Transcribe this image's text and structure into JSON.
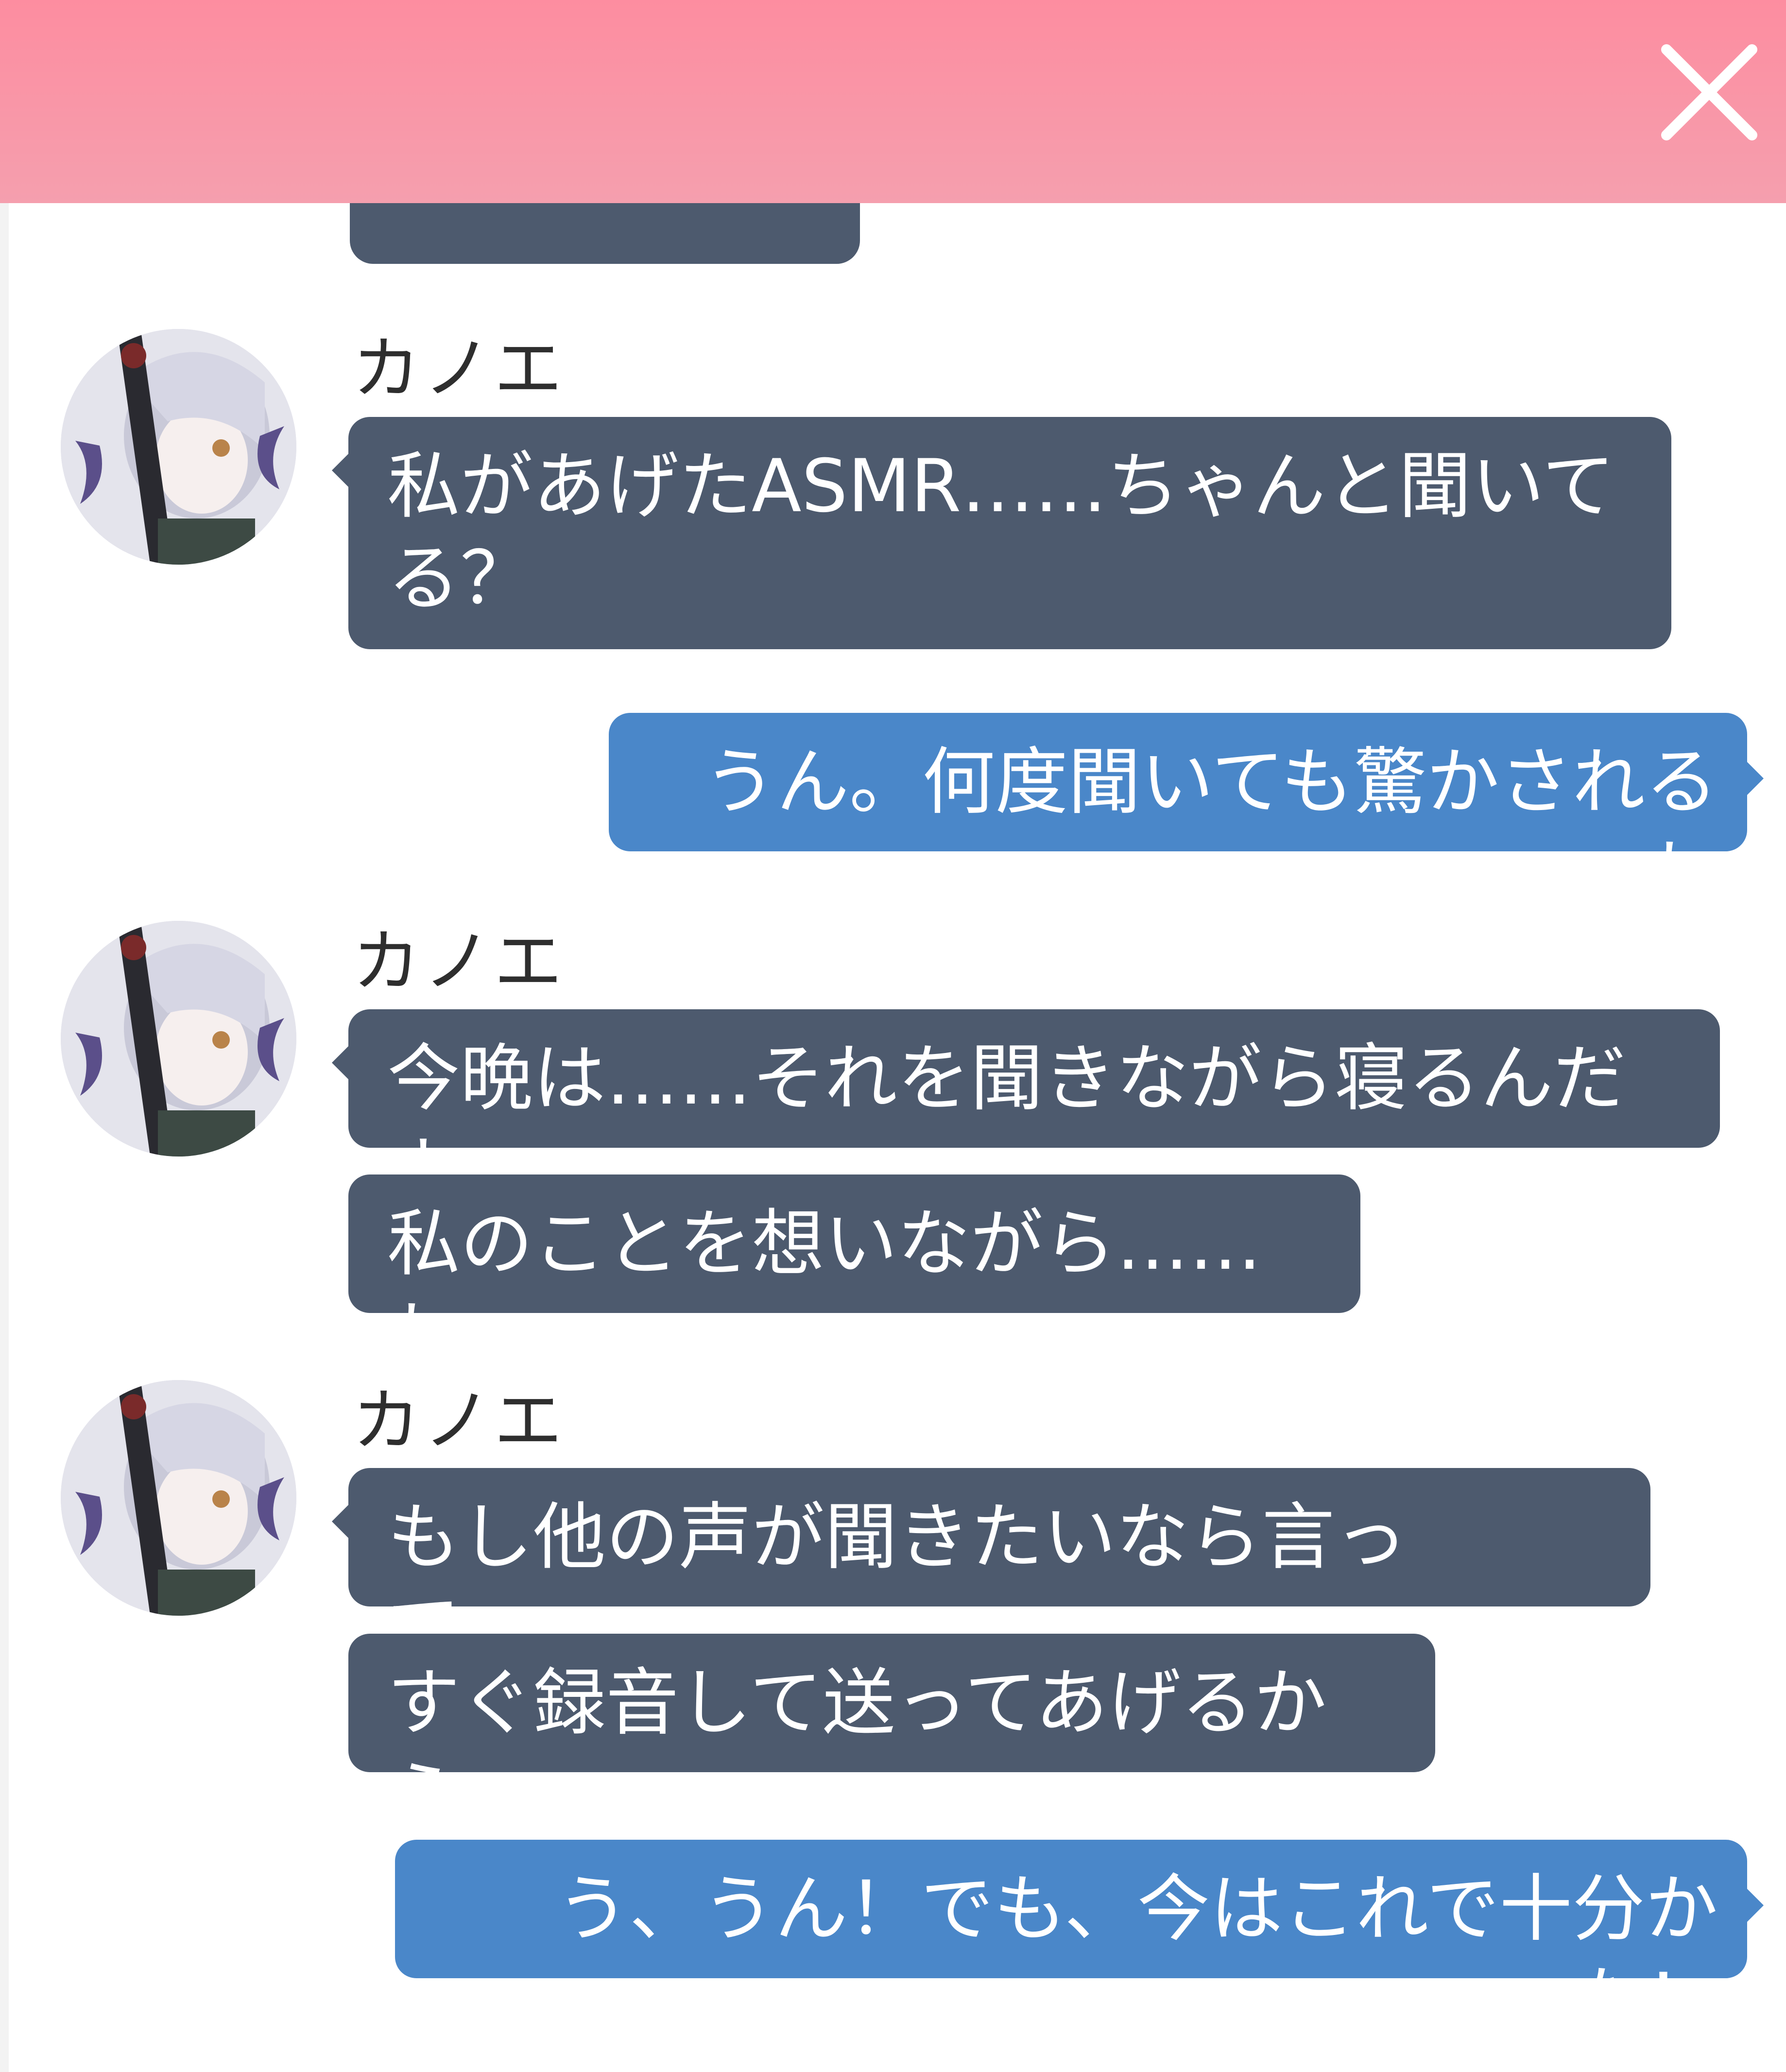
{
  "header": {
    "close_icon": "close-icon",
    "colors": {
      "top": "#fd8da0",
      "bottom": "#f59fae"
    }
  },
  "colors": {
    "incoming_bubble": "#4d5a6e",
    "outgoing_bubble": "#4a87c9",
    "bubble_text": "#ffffff",
    "name_text": "#2e2e2e"
  },
  "messages": [
    {
      "sender": "カノエ",
      "direction": "incoming",
      "bubbles": [
        "私があげたASMR……ちゃんと聞いて\nる？"
      ]
    },
    {
      "direction": "outgoing",
      "bubbles": [
        "うん。何度聞いても驚かされるね"
      ]
    },
    {
      "sender": "カノエ",
      "direction": "incoming",
      "bubbles": [
        "今晩は……それを聞きながら寝るんだよ",
        "私のことを想いながら……ね"
      ]
    },
    {
      "sender": "カノエ",
      "direction": "incoming",
      "bubbles": [
        "もし他の声が聞きたいなら言って……",
        "すぐ録音して送ってあげるから"
      ]
    },
    {
      "direction": "outgoing",
      "bubbles": [
        "う、うん！でも、今はこれで十分かな！"
      ]
    }
  ]
}
